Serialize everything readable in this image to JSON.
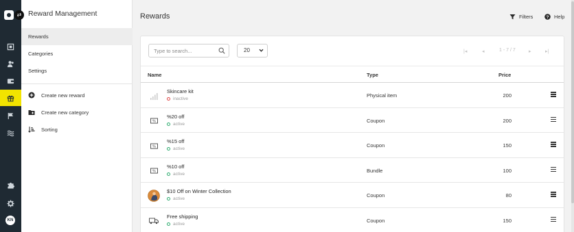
{
  "sidebar": {
    "avatar_initials": "KN",
    "icons": [
      "logo-icon",
      "swap-icon",
      "frame-icon",
      "users-icon",
      "wallet-icon",
      "gift-icon",
      "flag-icon",
      "waves-icon",
      "puzzle-icon",
      "gear-icon"
    ],
    "active_index": 3,
    "accent_color": "#f2e300"
  },
  "subnav": {
    "title": "Reward Management",
    "items": [
      {
        "label": "Rewards",
        "active": true
      },
      {
        "label": "Categories",
        "active": false
      },
      {
        "label": "Settings",
        "active": false
      }
    ],
    "actions": [
      {
        "label": "Create new reward",
        "icon": "plus-circle-icon"
      },
      {
        "label": "Create new category",
        "icon": "folder-plus-icon"
      },
      {
        "label": "Sorting",
        "icon": "sort-icon"
      }
    ]
  },
  "main": {
    "title": "Rewards",
    "filters_label": "Filters",
    "help_label": "Help"
  },
  "toolbar": {
    "search_placeholder": "Type to search...",
    "page_size": "20",
    "pagination_text": "1 - 7 / 7"
  },
  "table": {
    "columns": [
      "Name",
      "Type",
      "Price"
    ],
    "rows": [
      {
        "name": "Skincare kit",
        "status": "inactive",
        "type": "Physical item",
        "price": "200",
        "thumb": "signal-icon"
      },
      {
        "name": "%20 off",
        "status": "active",
        "type": "Coupon",
        "price": "200",
        "thumb": "coupon-icon"
      },
      {
        "name": "%15 off",
        "status": "active",
        "type": "Coupon",
        "price": "150",
        "thumb": "coupon-icon"
      },
      {
        "name": "%10 off",
        "status": "active",
        "type": "Bundle",
        "price": "100",
        "thumb": "coupon-icon"
      },
      {
        "name": "$10 Off on Winter Collection",
        "status": "active",
        "type": "Coupon",
        "price": "80",
        "thumb": "photo-thumbnail"
      },
      {
        "name": "Free shipping",
        "status": "active",
        "type": "Coupon",
        "price": "150",
        "thumb": "truck-icon"
      }
    ]
  },
  "colors": {
    "active_status": "#2eab6f",
    "inactive_status": "#e04848",
    "rail": "#1f2a33"
  }
}
